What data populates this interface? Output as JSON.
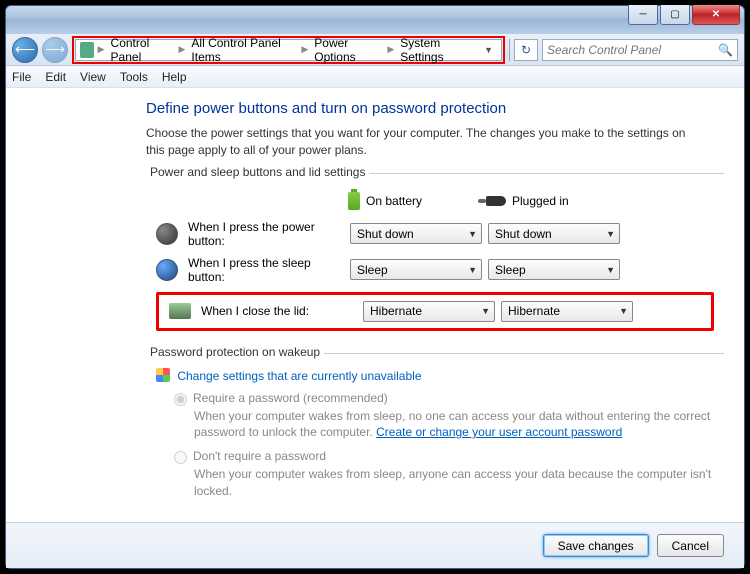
{
  "breadcrumb": {
    "items": [
      "Control Panel",
      "All Control Panel Items",
      "Power Options",
      "System Settings"
    ]
  },
  "search": {
    "placeholder": "Search Control Panel"
  },
  "menu": {
    "file": "File",
    "edit": "Edit",
    "view": "View",
    "tools": "Tools",
    "help": "Help"
  },
  "page": {
    "heading": "Define power buttons and turn on password protection",
    "desc": "Choose the power settings that you want for your computer. The changes you make to the settings on this page apply to all of your power plans."
  },
  "group1": {
    "title": "Power and sleep buttons and lid settings",
    "col_battery": "On battery",
    "col_plugged": "Plugged in",
    "rows": [
      {
        "label": "When I press the power button:",
        "battery": "Shut down",
        "plugged": "Shut down"
      },
      {
        "label": "When I press the sleep button:",
        "battery": "Sleep",
        "plugged": "Sleep"
      },
      {
        "label": "When I close the lid:",
        "battery": "Hibernate",
        "plugged": "Hibernate"
      }
    ]
  },
  "group2": {
    "title": "Password protection on wakeup",
    "change_link": "Change settings that are currently unavailable",
    "opt1": {
      "label": "Require a password (recommended)",
      "desc_a": "When your computer wakes from sleep, no one can access your data without entering the correct password to unlock the computer. ",
      "desc_link": "Create or change your user account password"
    },
    "opt2": {
      "label": "Don't require a password",
      "desc": "When your computer wakes from sleep, anyone can access your data because the computer isn't locked."
    }
  },
  "footer": {
    "save": "Save changes",
    "cancel": "Cancel"
  }
}
